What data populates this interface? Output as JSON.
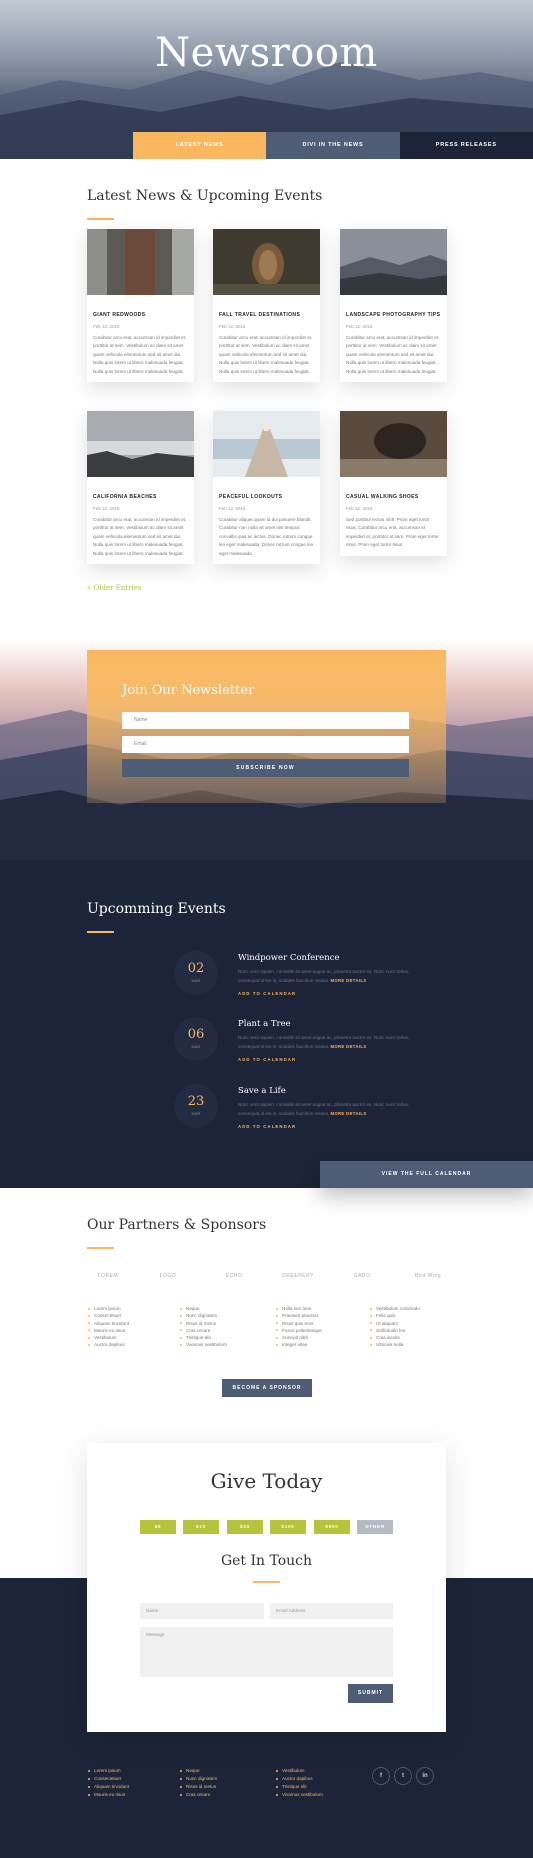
{
  "hero": {
    "title": "Newsroom"
  },
  "tabs": [
    "LATEST NEWS",
    "DIVI IN THE NEWS",
    "PRESS RELEASES"
  ],
  "news": {
    "title": "Latest News & Upcoming Events",
    "cards": [
      {
        "title": "GIANT REDWOODS",
        "date": "Feb 12, 2016",
        "excerpt": "Curabitur arcu erat, accumsan id imperdiet et, porttitor at sem. Vestibulum ac diam sit amet quam vehicula elementum sed sit amet dui. Nulla quis lorem ut libero malesuada feugiat. Nulla quis lorem ut libero malesuada feugiat."
      },
      {
        "title": "FALL TRAVEL DESTINATIONS",
        "date": "Feb 12, 2016",
        "excerpt": "Curabitur arcu erat, accumsan id imperdiet et, porttitor at sem. Vestibulum ac diam sit amet quam vehicula elementum sed sit amet dui. Nulla quis lorem ut libero malesuada feugiat. Nulla quis lorem ut libero malesuada feugiat."
      },
      {
        "title": "LANDSCAPE PHOTOGRAPHY TIPS",
        "date": "Feb 12, 2016",
        "excerpt": "Curabitur arcu erat, accumsan id imperdiet et, porttitor at sem. Vestibulum ac diam sit amet quam vehicula elementum sed sit amet dui. Nulla quis lorem ut libero malesuada feugiat. Nulla quis lorem ut libero malesuada feugiat."
      },
      {
        "title": "CALIFORNIA BEACHES",
        "date": "Feb 12, 2016",
        "excerpt": "Curabitur arcu erat, accumsan id imperdiet et, porttitor at sem. Vestibulum ac diam sit amet quam vehicula elementum sed sit amet dui. Nulla quis lorem ut libero malesuada feugiat. Nulla quis lorem ut libero malesuada feugiat."
      },
      {
        "title": "PEACEFUL LOOKOUTS",
        "date": "Feb 12, 2016",
        "excerpt": "Curabitur aliquet quam id dui posuere blandit. Curabitur non nulla sit amet nisl tempus convallis quis ac lectus. Donec rutrum congue leo eget malesuada. Donec rutrum congue leo eget malesuada."
      },
      {
        "title": "CASUAL WALKING SHOES",
        "date": "Feb 12, 2016",
        "excerpt": "Sed porttitor lectus nibh. Proin eget tortor risus. Curabitur arcu erat, accumsan id imperdiet et, porttitor at sem. Proin eget tortor risus. Proin eget tortor risus."
      }
    ],
    "older": "« Older Entries"
  },
  "newsletter": {
    "title": "Join Our Newsletter",
    "name_placeholder": "Name",
    "email_placeholder": "Email",
    "button": "SUBSCRIBE NOW"
  },
  "events": {
    "title": "Upcomming Events",
    "items": [
      {
        "day": "02",
        "month": "MAR",
        "title": "Windpower Conference",
        "desc": "Nunc vero sapien, convallis sit amet augue ac, pharetra auctor ex. Nunc nunc tellus, consequat id leo in, sodales faucibus massa.",
        "more": "MORE DETAILS",
        "add": "ADD TO CALENDAR"
      },
      {
        "day": "06",
        "month": "MAR",
        "title": "Plant a Tree",
        "desc": "Nunc vero sapien, convallis sit amet augue ac, pharetra auctor ex. Nunc nunc tellus, consequat id leo in, sodales faucibus massa.",
        "more": "MORE DETAILS",
        "add": "ADD TO CALENDAR"
      },
      {
        "day": "23",
        "month": "MAR",
        "title": "Save a Life",
        "desc": "Nunc vero sapien, convallis sit amet augue ac, pharetra auctor ex. Nunc nunc tellus, consequat id leo in, sodales faucibus massa.",
        "more": "MORE DETAILS",
        "add": "ADD TO CALENDAR"
      }
    ],
    "full_calendar": "VIEW THE FULL CALENDAR"
  },
  "partners": {
    "title": "Our Partners & Sponsors",
    "logos": [
      "LOREM",
      "LOGO",
      "ECHO",
      "GREENERY",
      "GABO",
      "Bird Wing"
    ],
    "lists": [
      [
        "Lorem ipsum",
        "Consectetuer",
        "Aliquam tincidunt",
        "Mauris eu risus",
        "Vestibulum",
        "Auctor dapibus"
      ],
      [
        "Neque",
        "Nunc dignissim",
        "Risus id metus",
        "Cras ornare",
        "Tristique elit",
        "Vivamus vestibulum"
      ],
      [
        "Nulla nec ante",
        "Praesent placerat",
        "Risus quis eros",
        "Fusce pellentesque",
        "Suscipit nibh",
        "Integer vitae"
      ],
      [
        "Vestibulum commodo",
        "Felis quis",
        "Ut aliquam",
        "Sollicitudin leo",
        "Cras iaculis",
        "Ultricies nulla"
      ]
    ],
    "button": "BECOME A SPONSOR"
  },
  "give": {
    "title": "Give Today",
    "amounts": [
      "$5",
      "$10",
      "$50",
      "$100",
      "$500",
      "OTHER"
    ],
    "touch_title": "Get In Touch",
    "name_placeholder": "Name",
    "email_placeholder": "Email Address",
    "message_placeholder": "Message",
    "submit": "SUBMIT"
  },
  "footer": {
    "lists": [
      [
        "Lorem ipsum",
        "Consectetuer",
        "Aliquam tincidunt",
        "Mauris eu risus"
      ],
      [
        "Neque",
        "Nunc dignissim",
        "Risus id metus",
        "Cras ornare"
      ],
      [
        "Vestibulum",
        "Auctor dapibus",
        "Tristique elit",
        "Vivamus vestibulum"
      ]
    ],
    "social": [
      "f",
      "t",
      "in"
    ]
  },
  "colors": {
    "accent": "#f9b85f",
    "navy": "#1c2439",
    "slate": "#4e5c76",
    "green": "#b7c33b"
  }
}
